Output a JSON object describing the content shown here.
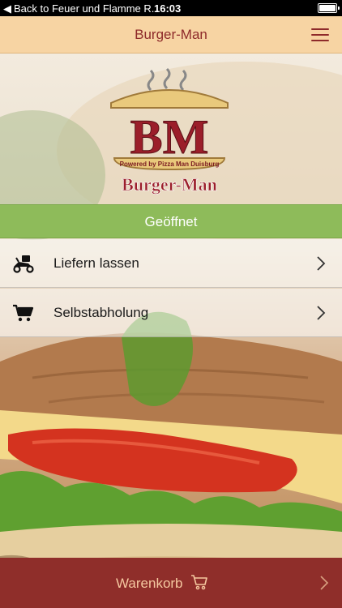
{
  "status_bar": {
    "back_label": "Back to Feuer und Flamme R...",
    "time": "16:03"
  },
  "nav": {
    "title": "Burger-Man",
    "menu_icon": "hamburger-menu-icon"
  },
  "logo": {
    "initials": "BM",
    "tagline": "Powered by Pizza Man Duisburg",
    "name": "Burger-Man"
  },
  "status": {
    "label": "Geöffnet",
    "color": "#8ebb5a"
  },
  "menu": {
    "items": [
      {
        "label": "Liefern lassen",
        "icon": "delivery-scooter-icon"
      },
      {
        "label": "Selbstabholung",
        "icon": "shopping-cart-icon"
      }
    ]
  },
  "cart": {
    "label": "Warenkorb",
    "icon": "shopping-cart-icon",
    "color": "#8f2e2a"
  },
  "colors": {
    "brand_red": "#8e2a2a",
    "nav_bg": "#f7d4a3",
    "open_green": "#8ebb5a"
  }
}
